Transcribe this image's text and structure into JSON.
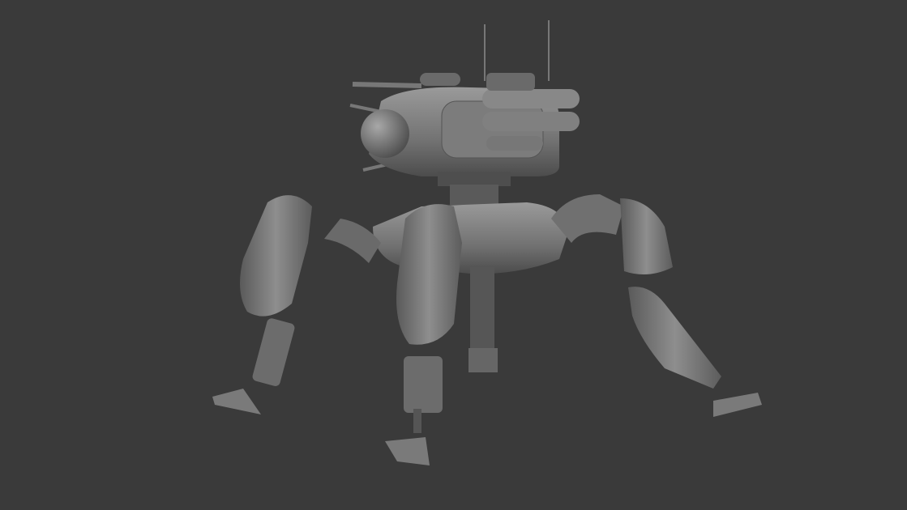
{
  "scene": {
    "subject": "walker-mech-render",
    "colors": {
      "background": "#3a3a3a",
      "body_light": "#8a8a8a",
      "body_mid": "#6e6e6e",
      "body_dark": "#4a4a4a",
      "shadow": "#2e2e2e"
    }
  }
}
